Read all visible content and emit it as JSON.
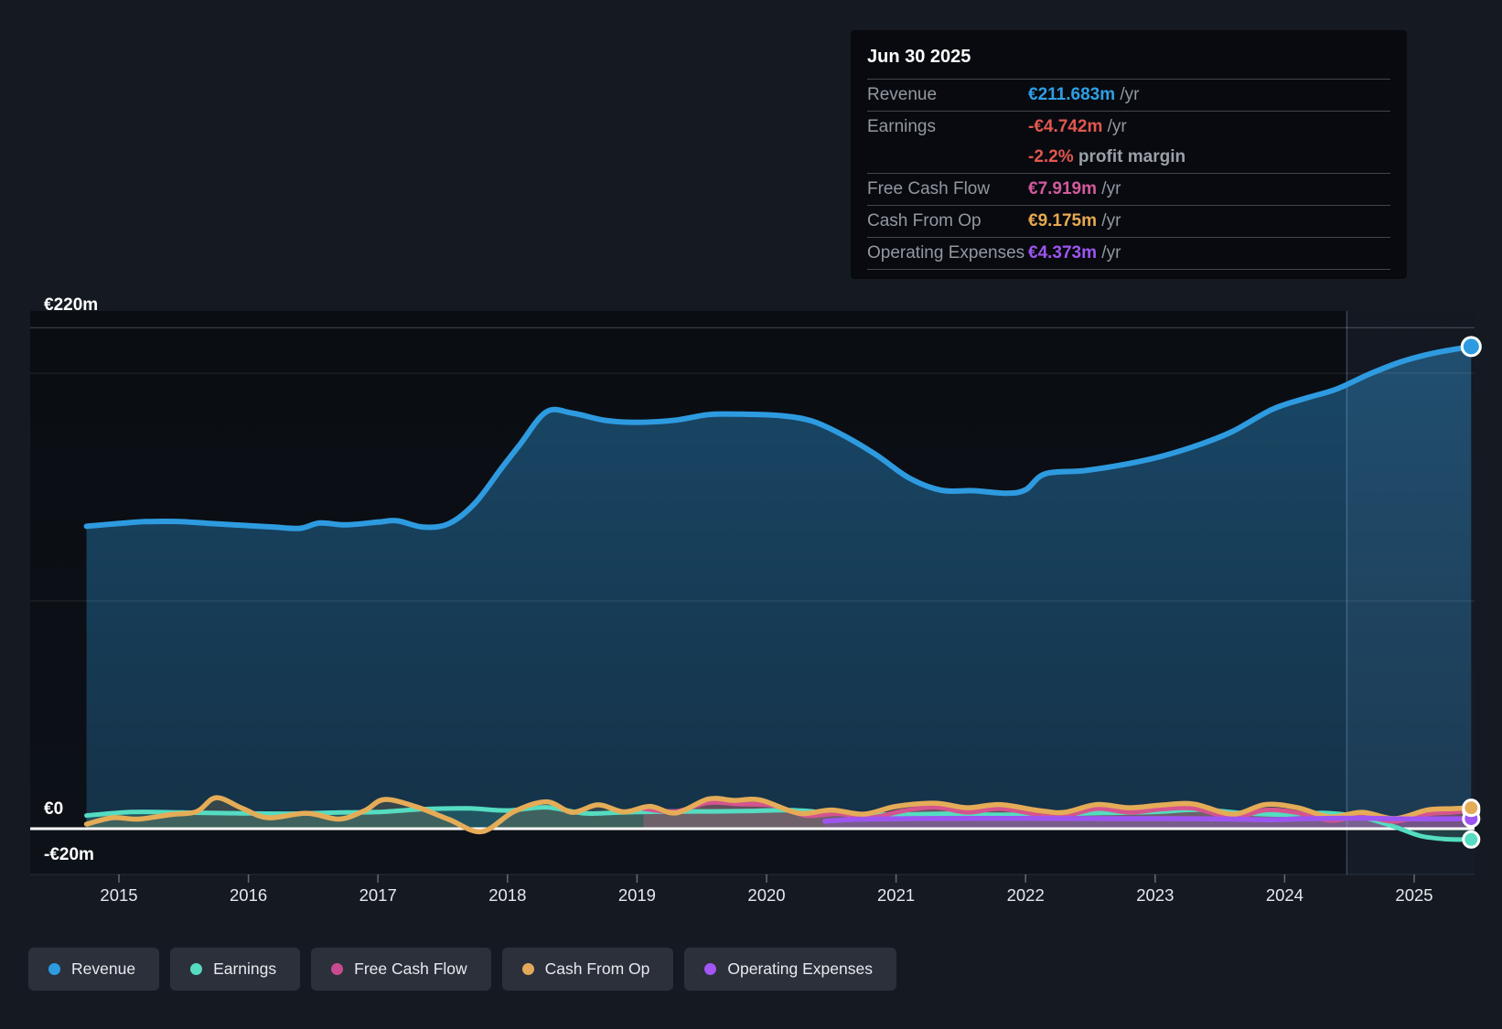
{
  "chart_data": {
    "type": "area",
    "unit": "€m",
    "y_axis": {
      "top_label": "€220m",
      "zero_label": "€0",
      "bottom_label": "-€20m",
      "max": 220,
      "min": -20,
      "gridline_values": [
        220,
        200,
        100
      ]
    },
    "x_ticks": [
      "2015",
      "2016",
      "2017",
      "2018",
      "2019",
      "2020",
      "2021",
      "2022",
      "2023",
      "2024",
      "2025"
    ],
    "highlight_band": {
      "from_year": 2024.48,
      "to_year": 2025.47
    },
    "series": [
      {
        "name": "Revenue",
        "color": "#2E9BE0",
        "points": [
          [
            2014.75,
            132.8
          ],
          [
            2015.0,
            134.0
          ],
          [
            2015.2,
            134.8
          ],
          [
            2015.45,
            134.9
          ],
          [
            2015.7,
            134.0
          ],
          [
            2015.95,
            133.2
          ],
          [
            2016.2,
            132.4
          ],
          [
            2016.4,
            131.9
          ],
          [
            2016.55,
            134.2
          ],
          [
            2016.75,
            133.4
          ],
          [
            2017.0,
            134.6
          ],
          [
            2017.15,
            135.2
          ],
          [
            2017.35,
            132.4
          ],
          [
            2017.55,
            134.0
          ],
          [
            2017.75,
            143.0
          ],
          [
            2017.95,
            158.0
          ],
          [
            2018.1,
            169.0
          ],
          [
            2018.3,
            183.0
          ],
          [
            2018.5,
            182.5
          ],
          [
            2018.75,
            179.3
          ],
          [
            2019.0,
            178.4
          ],
          [
            2019.3,
            179.4
          ],
          [
            2019.55,
            181.8
          ],
          [
            2019.8,
            182.0
          ],
          [
            2020.1,
            181.4
          ],
          [
            2020.35,
            179.0
          ],
          [
            2020.6,
            172.5
          ],
          [
            2020.85,
            164.0
          ],
          [
            2021.1,
            154.0
          ],
          [
            2021.35,
            148.6
          ],
          [
            2021.6,
            148.4
          ],
          [
            2021.85,
            147.3
          ],
          [
            2022.0,
            148.8
          ],
          [
            2022.15,
            155.8
          ],
          [
            2022.45,
            157.2
          ],
          [
            2022.75,
            159.8
          ],
          [
            2023.05,
            163.5
          ],
          [
            2023.35,
            168.8
          ],
          [
            2023.6,
            174.5
          ],
          [
            2023.9,
            184.0
          ],
          [
            2024.15,
            188.8
          ],
          [
            2024.4,
            193.0
          ],
          [
            2024.65,
            199.5
          ],
          [
            2024.9,
            205.0
          ],
          [
            2025.15,
            208.8
          ],
          [
            2025.44,
            211.683
          ]
        ]
      },
      {
        "name": "Earnings",
        "color": "#55DCC1",
        "points": [
          [
            2014.75,
            5.8
          ],
          [
            2015.1,
            7.3
          ],
          [
            2015.5,
            7.1
          ],
          [
            2015.9,
            6.8
          ],
          [
            2016.3,
            6.6
          ],
          [
            2016.7,
            7.1
          ],
          [
            2017.0,
            7.3
          ],
          [
            2017.35,
            8.6
          ],
          [
            2017.7,
            8.9
          ],
          [
            2018.0,
            8.0
          ],
          [
            2018.3,
            9.4
          ],
          [
            2018.6,
            6.7
          ],
          [
            2018.9,
            7.2
          ],
          [
            2019.2,
            7.5
          ],
          [
            2019.6,
            7.6
          ],
          [
            2019.9,
            7.8
          ],
          [
            2020.2,
            8.1
          ],
          [
            2020.6,
            6.6
          ],
          [
            2021.0,
            6.2
          ],
          [
            2021.4,
            6.6
          ],
          [
            2021.8,
            6.1
          ],
          [
            2022.2,
            6.4
          ],
          [
            2022.6,
            6.9
          ],
          [
            2023.0,
            7.4
          ],
          [
            2023.35,
            8.3
          ],
          [
            2023.7,
            6.7
          ],
          [
            2024.0,
            6.2
          ],
          [
            2024.3,
            6.9
          ],
          [
            2024.6,
            5.0
          ],
          [
            2024.85,
            0.8
          ],
          [
            2025.05,
            -3.2
          ],
          [
            2025.25,
            -4.6
          ],
          [
            2025.44,
            -4.742
          ]
        ]
      },
      {
        "name": "Free Cash Flow",
        "color": "#D4548F",
        "points": [
          [
            2019.05,
            8.8
          ],
          [
            2019.3,
            7.6
          ],
          [
            2019.55,
            11.4
          ],
          [
            2019.8,
            10.8
          ],
          [
            2020.05,
            10.2
          ],
          [
            2020.3,
            5.8
          ],
          [
            2020.55,
            6.6
          ],
          [
            2020.8,
            4.8
          ],
          [
            2021.05,
            7.8
          ],
          [
            2021.3,
            9.4
          ],
          [
            2021.55,
            7.2
          ],
          [
            2021.8,
            8.8
          ],
          [
            2022.1,
            6.2
          ],
          [
            2022.3,
            5.6
          ],
          [
            2022.55,
            8.8
          ],
          [
            2022.8,
            7.2
          ],
          [
            2023.05,
            8.6
          ],
          [
            2023.3,
            8.9
          ],
          [
            2023.6,
            4.8
          ],
          [
            2023.85,
            8.2
          ],
          [
            2024.1,
            7.0
          ],
          [
            2024.35,
            3.6
          ],
          [
            2024.6,
            5.4
          ],
          [
            2024.85,
            3.2
          ],
          [
            2025.1,
            6.4
          ],
          [
            2025.3,
            7.2
          ],
          [
            2025.44,
            7.919
          ]
        ]
      },
      {
        "name": "Cash From Op",
        "color": "#E5AC58",
        "points": [
          [
            2014.75,
            2.0
          ],
          [
            2014.95,
            4.8
          ],
          [
            2015.15,
            4.2
          ],
          [
            2015.4,
            6.2
          ],
          [
            2015.6,
            7.5
          ],
          [
            2015.75,
            13.6
          ],
          [
            2015.95,
            9.0
          ],
          [
            2016.15,
            4.8
          ],
          [
            2016.45,
            6.8
          ],
          [
            2016.7,
            4.2
          ],
          [
            2016.9,
            8.0
          ],
          [
            2017.05,
            12.8
          ],
          [
            2017.3,
            9.5
          ],
          [
            2017.55,
            4.0
          ],
          [
            2017.8,
            -1.3
          ],
          [
            2018.05,
            7.5
          ],
          [
            2018.3,
            11.8
          ],
          [
            2018.5,
            7.2
          ],
          [
            2018.7,
            10.5
          ],
          [
            2018.9,
            7.4
          ],
          [
            2019.1,
            9.8
          ],
          [
            2019.3,
            6.9
          ],
          [
            2019.55,
            13.0
          ],
          [
            2019.75,
            12.4
          ],
          [
            2019.95,
            12.6
          ],
          [
            2020.25,
            6.8
          ],
          [
            2020.5,
            8.2
          ],
          [
            2020.75,
            6.4
          ],
          [
            2021.0,
            9.8
          ],
          [
            2021.3,
            11.2
          ],
          [
            2021.55,
            9.2
          ],
          [
            2021.8,
            10.6
          ],
          [
            2022.1,
            8.0
          ],
          [
            2022.3,
            7.2
          ],
          [
            2022.55,
            10.6
          ],
          [
            2022.8,
            9.2
          ],
          [
            2023.05,
            10.4
          ],
          [
            2023.3,
            10.8
          ],
          [
            2023.6,
            6.4
          ],
          [
            2023.85,
            10.6
          ],
          [
            2024.1,
            9.2
          ],
          [
            2024.35,
            5.2
          ],
          [
            2024.6,
            7.2
          ],
          [
            2024.85,
            4.4
          ],
          [
            2025.1,
            8.2
          ],
          [
            2025.3,
            8.8
          ],
          [
            2025.44,
            9.175
          ]
        ]
      },
      {
        "name": "Operating Expenses",
        "color": "#9D55F1",
        "points": [
          [
            2020.45,
            3.3
          ],
          [
            2020.7,
            4.1
          ],
          [
            2021.1,
            4.4
          ],
          [
            2021.6,
            4.5
          ],
          [
            2022.1,
            4.5
          ],
          [
            2022.6,
            4.4
          ],
          [
            2023.1,
            4.4
          ],
          [
            2023.6,
            4.2
          ],
          [
            2023.9,
            3.9
          ],
          [
            2024.2,
            4.4
          ],
          [
            2024.6,
            4.6
          ],
          [
            2024.9,
            4.3
          ],
          [
            2025.2,
            4.3
          ],
          [
            2025.44,
            4.373
          ]
        ]
      }
    ]
  },
  "tooltip": {
    "date": "Jun 30 2025",
    "rows": [
      {
        "label": "Revenue",
        "value": "€211.683m",
        "unit": "/yr",
        "color": "#2E9FE6"
      },
      {
        "label": "Earnings",
        "value": "-€4.742m",
        "unit": "/yr",
        "color": "#E2574F",
        "sub_value": "-2.2%",
        "sub_text": "profit margin",
        "sub_color": "#E2574F"
      },
      {
        "label": "Free Cash Flow",
        "value": "€7.919m",
        "unit": "/yr",
        "color": "#D45A9E"
      },
      {
        "label": "Cash From Op",
        "value": "€9.175m",
        "unit": "/yr",
        "color": "#E8A950"
      },
      {
        "label": "Operating Expenses",
        "value": "€4.373m",
        "unit": "/yr",
        "color": "#9D55F1"
      }
    ]
  },
  "legend": {
    "items": [
      {
        "label": "Revenue",
        "color": "#2E9BE0"
      },
      {
        "label": "Earnings",
        "color": "#55DCC1"
      },
      {
        "label": "Free Cash Flow",
        "color": "#C94B8F"
      },
      {
        "label": "Cash From Op",
        "color": "#E3A95A"
      },
      {
        "label": "Operating Expenses",
        "color": "#A355F6"
      }
    ]
  }
}
